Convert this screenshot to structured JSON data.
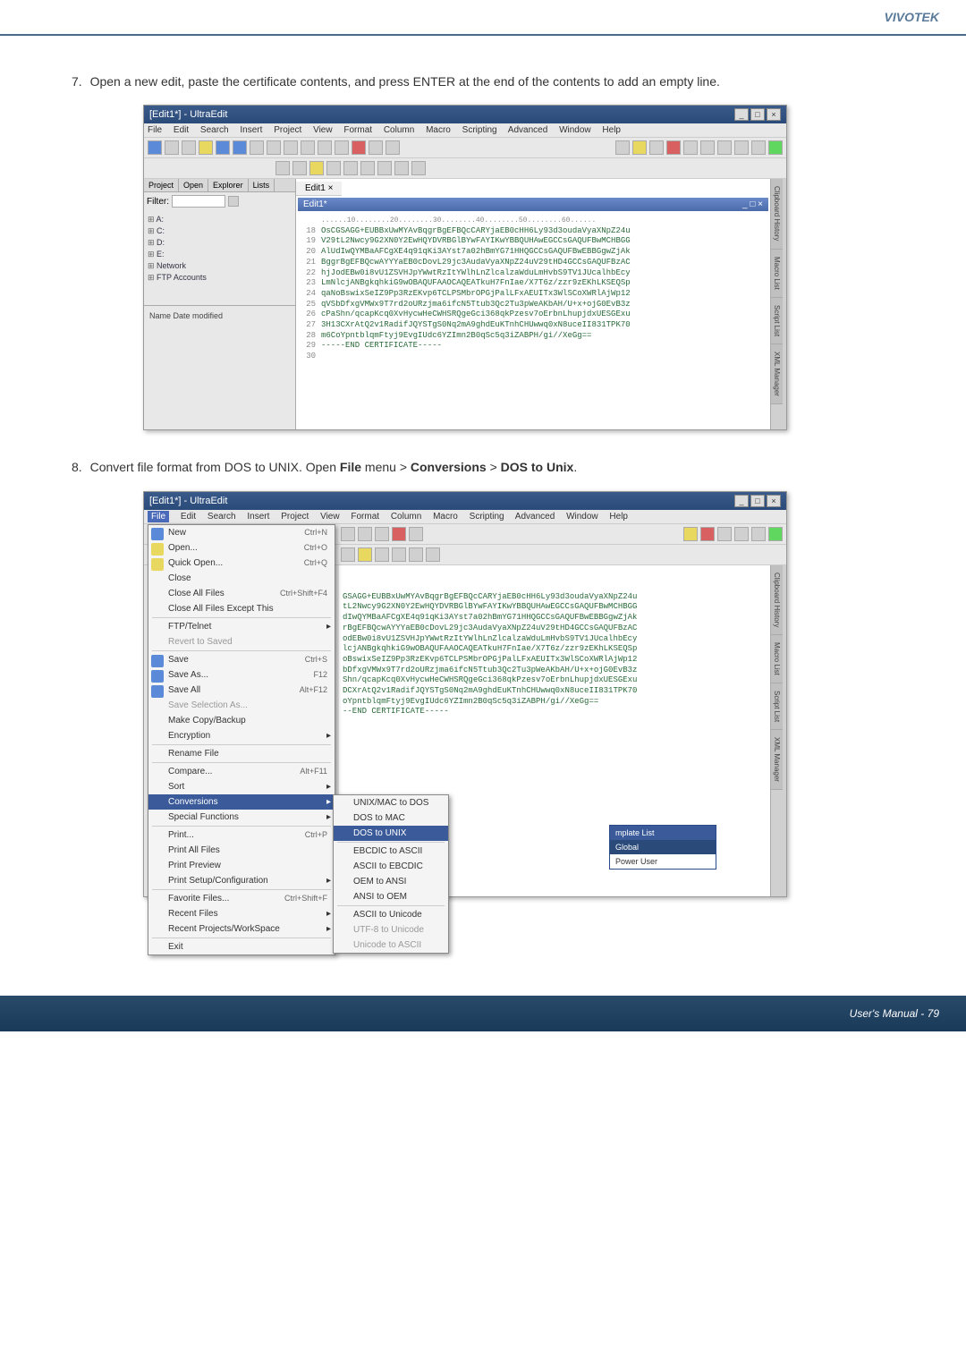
{
  "brand": "VIVOTEK",
  "steps": {
    "step7_num": "7.",
    "step7_text": "Open a new edit, paste the certificate contents, and press ENTER at the end of the contents to add an empty line.",
    "step8_num": "8.",
    "step8_pre": "Convert file format from DOS to UNIX. Open ",
    "step8_file": "File",
    "step8_mid": " menu > ",
    "step8_conv": "Conversions",
    "step8_mid2": " > ",
    "step8_dos": "DOS to Unix",
    "step8_end": "."
  },
  "editor1": {
    "title": "[Edit1*] - UltraEdit",
    "menus": [
      "File",
      "Edit",
      "Search",
      "Insert",
      "Project",
      "View",
      "Format",
      "Column",
      "Macro",
      "Scripting",
      "Advanced",
      "Window",
      "Help"
    ],
    "panel_tabs": [
      "Project",
      "Open",
      "Explorer",
      "Lists"
    ],
    "filter_label": "Filter:",
    "tree_items": [
      "A:",
      "C:",
      "D:",
      "E:",
      "Network",
      "FTP Accounts"
    ],
    "bottom_headers": "Name            Date modified",
    "file_tab": "Edit1 ×",
    "child_title": "Edit1*",
    "ruler": "......10........20........30........40........50........60......",
    "code_lines": [
      {
        "num": "18",
        "txt": "OsCGSAGG+EUBBxUwMYAvBqgrBgEFBQcCARYjaEB0cHH6Ly93d3oudaVyaXNpZ24u"
      },
      {
        "num": "19",
        "txt": "V29tL2Nwcy9G2XN0Y2EwHQYDVRBGlBYwFAYIKwYBBQUHAwEGCCsGAQUFBwMCHBGG"
      },
      {
        "num": "20",
        "txt": "AlUdIwQYMBaAFCgXE4q91qKi3AYst7a02hBmYG71HHQGCCsGAQUFBwEBBGgwZjAk"
      },
      {
        "num": "21",
        "txt": "BggrBgEFBQcwAYYYaEB0cDovL29jc3AudaVyaXNpZ24uV29tHD4GCCsGAQUFBzAC"
      },
      {
        "num": "22",
        "txt": "hjJodEBw0i8vU1ZSVHJpYWwtRzItYWlhLnZlcalzaWduLmHvbS9TV1JUcalhbEcy"
      },
      {
        "num": "23",
        "txt": "LmNlcjANBgkqhkiG9wOBAQUFAAOCAQEATkuH7FnIae/X7T6z/zzr9zEKhLKSEQSp"
      },
      {
        "num": "24",
        "txt": "qaNoBswixSeIZ9Pp3RzEKvp6TCLPSMbrOPGjPalLFxAEUITx3WlSCoXWRlAjWp12"
      },
      {
        "num": "25",
        "txt": "qVSbDfxgVMWx9T7rd2oURzjma6ifcN5Ttub3Qc2Tu3pWeAKbAH/U+x+ojG0EvB3z"
      },
      {
        "num": "26",
        "txt": "cPaShn/qcapKcq0XvHycwHeCWHSRQgeGci368qkPzesv7oErbnLhupjdxUESGExu"
      },
      {
        "num": "27",
        "txt": "3H13CXrAtQ2v1RadifJQYSTgS0Nq2mA9ghdEuKTnhCHUwwq0xN8uceII831TPK70"
      },
      {
        "num": "28",
        "txt": "m6CoYpntblqmFtyj9EvgIUdc6YZImn2B0qSc5q3iZABPH/gi//XeGg=="
      },
      {
        "num": "29",
        "txt": "-----END CERTIFICATE-----"
      },
      {
        "num": "30",
        "txt": ""
      }
    ],
    "vtabs": [
      "Clipboard History",
      "Macro List",
      "Script List",
      "XML Manager"
    ]
  },
  "editor2": {
    "title": "[Edit1*] - UltraEdit",
    "file_menu": {
      "items": [
        {
          "label": "New",
          "shortcut": "Ctrl+N",
          "icon": "blue"
        },
        {
          "label": "Open...",
          "shortcut": "Ctrl+O",
          "icon": "yel"
        },
        {
          "label": "Quick Open...",
          "shortcut": "Ctrl+Q",
          "icon": "yel"
        },
        {
          "label": "Close",
          "shortcut": "",
          "icon": ""
        },
        {
          "label": "Close All Files",
          "shortcut": "Ctrl+Shift+F4",
          "icon": ""
        },
        {
          "label": "Close All Files Except This",
          "shortcut": "",
          "icon": ""
        },
        {
          "sep": true
        },
        {
          "label": "FTP/Telnet",
          "shortcut": "",
          "arrow": true
        },
        {
          "label": "Revert to Saved",
          "shortcut": "",
          "disabled": true
        },
        {
          "sep": true
        },
        {
          "label": "Save",
          "shortcut": "Ctrl+S",
          "icon": "blue"
        },
        {
          "label": "Save As...",
          "shortcut": "F12",
          "icon": "blue"
        },
        {
          "label": "Save All",
          "shortcut": "Alt+F12",
          "icon": "blue"
        },
        {
          "label": "Save Selection As...",
          "shortcut": "",
          "disabled": true
        },
        {
          "label": "Make Copy/Backup",
          "shortcut": "",
          "icon": ""
        },
        {
          "label": "Encryption",
          "shortcut": "",
          "arrow": true
        },
        {
          "sep": true
        },
        {
          "label": "Rename File",
          "shortcut": "",
          "icon": ""
        },
        {
          "sep": true
        },
        {
          "label": "Compare...",
          "shortcut": "Alt+F11",
          "icon": ""
        },
        {
          "label": "Sort",
          "shortcut": "",
          "arrow": true
        },
        {
          "label": "Conversions",
          "shortcut": "",
          "arrow": true,
          "hl": true
        },
        {
          "label": "Special Functions",
          "shortcut": "",
          "arrow": true
        },
        {
          "sep": true
        },
        {
          "label": "Print...",
          "shortcut": "Ctrl+P",
          "icon": ""
        },
        {
          "label": "Print All Files",
          "shortcut": "",
          "icon": ""
        },
        {
          "label": "Print Preview",
          "shortcut": "",
          "icon": ""
        },
        {
          "label": "Print Setup/Configuration",
          "shortcut": "",
          "arrow": true
        },
        {
          "sep": true
        },
        {
          "label": "Favorite Files...",
          "shortcut": "Ctrl+Shift+F",
          "icon": ""
        },
        {
          "label": "Recent Files",
          "shortcut": "",
          "arrow": true
        },
        {
          "label": "Recent Projects/WorkSpace",
          "shortcut": "",
          "arrow": true
        },
        {
          "sep": true
        },
        {
          "label": "Exit",
          "shortcut": "",
          "icon": ""
        }
      ]
    },
    "submenu": [
      {
        "label": "UNIX/MAC to DOS"
      },
      {
        "label": "DOS to MAC"
      },
      {
        "label": "DOS to UNIX",
        "hl": true
      },
      {
        "sep": true
      },
      {
        "label": "EBCDIC to ASCII"
      },
      {
        "label": "ASCII to EBCDIC"
      },
      {
        "label": "OEM to ANSI"
      },
      {
        "label": "ANSI to OEM"
      },
      {
        "sep": true
      },
      {
        "label": "ASCII to Unicode"
      },
      {
        "label": "UTF-8 to Unicode",
        "disabled": true
      },
      {
        "label": "Unicode to ASCII",
        "disabled": true
      }
    ],
    "template_popup": {
      "header": "mplate List",
      "rows": [
        "Global",
        "Power User"
      ]
    },
    "code_visible": [
      "GSAGG+EUBBxUwMYAvBqgrBgEFBQcCARYjaEB0cHH6Ly93d3oudaVyaXNpZ24u",
      "tL2Nwcy9G2XN0Y2EwHQYDVRBGlBYwFAYIKwYBBQUHAwEGCCsGAQUFBwMCHBGG",
      "dIwQYMBaAFCgXE4q91qKi3AYst7a02hBmYG71HHQGCCsGAQUFBwEBBGgwZjAk",
      "rBgEFBQcwAYYYaEB0cDovL29jc3AudaVyaXNpZ24uV29tHD4GCCsGAQUFBzAC",
      "odEBw0i8vU1ZSVHJpYWwtRzItYWlhLnZlcalzaWduLmHvbS9TV1JUcalhbEcy",
      "lcjANBgkqhkiG9wOBAQUFAAOCAQEATkuH7FnIae/X7T6z/zzr9zEKhLKSEQSp",
      "oBswixSeIZ9Pp3RzEKvp6TCLPSMbrOPGjPalLFxAEUITx3WlSCoXWRlAjWp12",
      "bDfxgVMWx9T7rd2oURzjma6ifcN5Ttub3Qc2Tu3pWeAKbAH/U+x+ojG0EvB3z",
      "Shn/qcapKcq0XvHycwHeCWHSRQgeGci368qkPzesv7oErbnLhupjdxUESGExu",
      "DCXrAtQ2v1RadifJQYSTgS0Nq2mA9ghdEuKTnhCHUwwq0xN8uceII831TPK70",
      "oYpntblqmFtyj9EvgIUdc6YZImn2B0qSc5q3iZABPH/gi//XeGg==",
      "--END CERTIFICATE-----"
    ]
  },
  "footer": "User's Manual - 79"
}
